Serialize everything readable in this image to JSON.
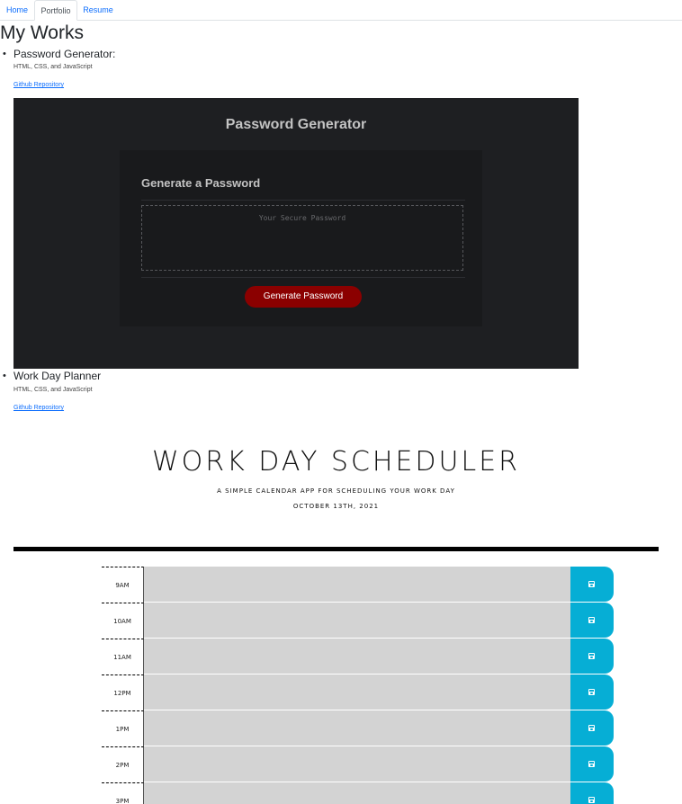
{
  "tabs": [
    {
      "label": "Home"
    },
    {
      "label": "Portfolio"
    },
    {
      "label": "Resume"
    }
  ],
  "page_title": "My Works",
  "bullet": "•",
  "projects": [
    {
      "title": "Password Generator:",
      "tech": "HTML, CSS, and JavaScript",
      "link_label": "Github Repository",
      "preview": {
        "heading": "Password Generator",
        "card_heading": "Generate a Password",
        "placeholder": "Your Secure Password",
        "button_label": "Generate Password"
      }
    },
    {
      "title": "Work Day Planner",
      "tech": "HTML, CSS, and JavaScript",
      "link_label": "Github Repository",
      "preview": {
        "heading": "Work Day Scheduler",
        "lead": "A simple calendar app for scheduling your work day",
        "date": "October 13th, 2021",
        "hours": [
          "9am",
          "10am",
          "11am",
          "12pm",
          "1pm",
          "2pm",
          "3pm"
        ]
      }
    }
  ],
  "colors": {
    "link": "#0d6efd",
    "pw_bg": "#1e1f22",
    "pw_button": "#8b0000",
    "save_button": "#06aed5",
    "timeblock": "#d3d3d3"
  },
  "icons": {
    "save": "floppy-disk-icon"
  }
}
